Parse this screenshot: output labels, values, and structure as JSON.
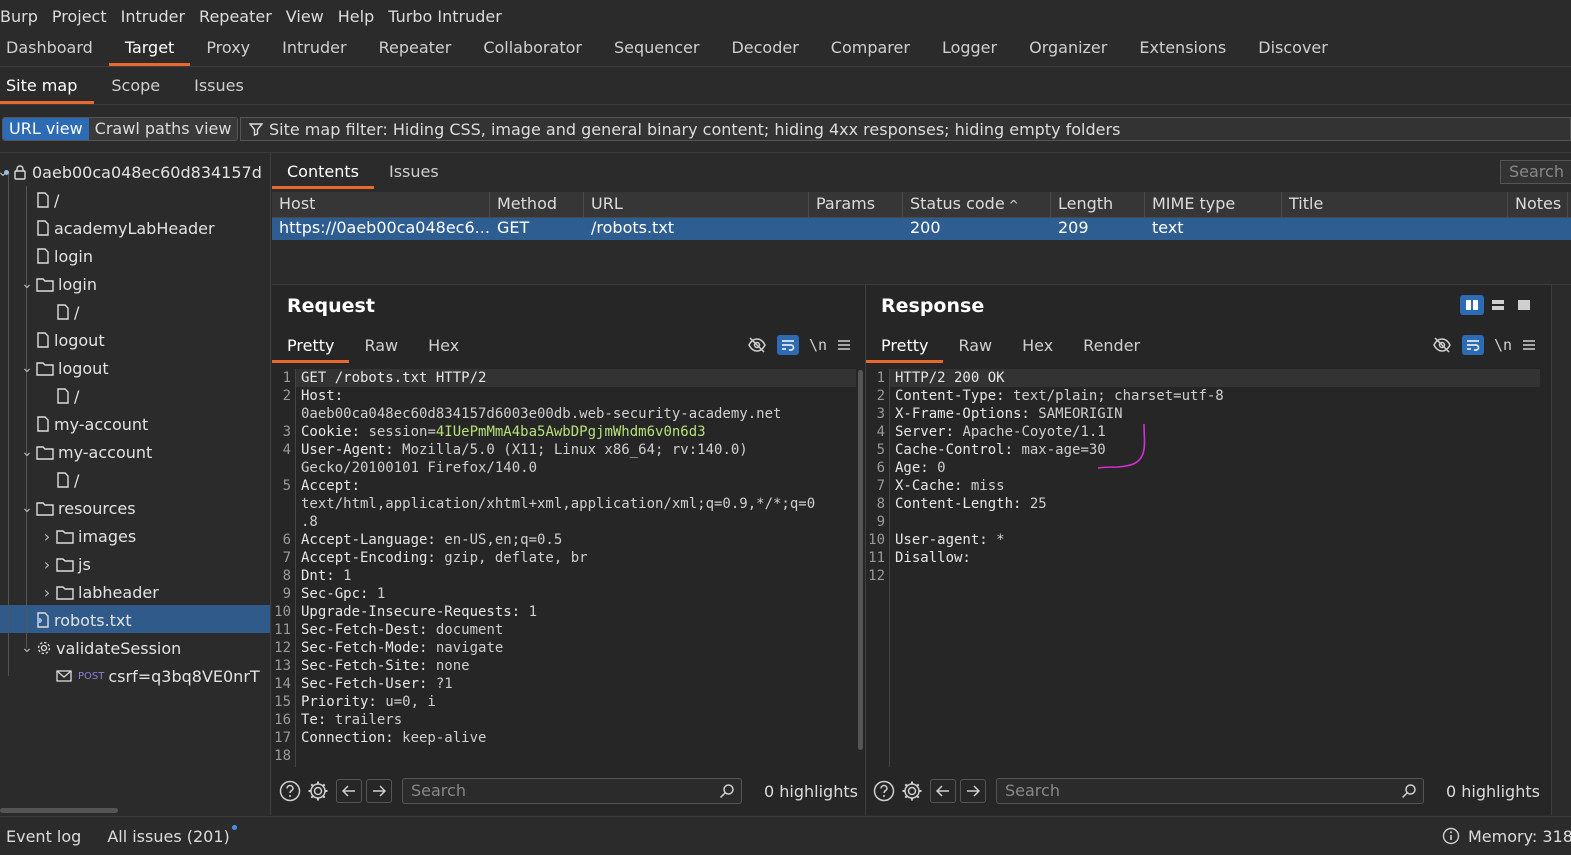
{
  "menu": [
    "Burp",
    "Project",
    "Intruder",
    "Repeater",
    "View",
    "Help",
    "Turbo Intruder"
  ],
  "main_tabs": [
    "Dashboard",
    "Target",
    "Proxy",
    "Intruder",
    "Repeater",
    "Collaborator",
    "Sequencer",
    "Decoder",
    "Comparer",
    "Logger",
    "Organizer",
    "Extensions",
    "Discover"
  ],
  "main_active": "Target",
  "sub_tabs": [
    "Site map",
    "Scope",
    "Issues"
  ],
  "view_toggle": {
    "url_view": "URL view",
    "crawl_view": "Crawl paths view"
  },
  "filter_text": "Site map filter: Hiding CSS, image and general binary content; hiding 4xx responses; hiding empty folders",
  "tree": {
    "root": "0aeb00ca048ec60d834157d",
    "items": [
      "/",
      "academyLabHeader",
      "login",
      "login",
      "/",
      "logout",
      "logout",
      "/",
      "my-account",
      "my-account",
      "/",
      "resources",
      "images",
      "js",
      "labheader",
      "robots.txt",
      "validateSession",
      "csrf=q3bq8VE0nrT"
    ],
    "post_badge": "POST"
  },
  "content_tabs": [
    "Contents",
    "Issues"
  ],
  "content_search_placeholder": "Search",
  "table": {
    "columns": [
      "Host",
      "Method",
      "URL",
      "Params",
      "Status code",
      "Length",
      "MIME type",
      "Title",
      "Notes"
    ],
    "sort_indicator": "^",
    "row": {
      "host": "https://0aeb00ca048ec6...",
      "method": "GET",
      "url": "/robots.txt",
      "params": "",
      "status": "200",
      "length": "209",
      "mime": "text",
      "title": "",
      "notes": ""
    }
  },
  "request": {
    "title": "Request",
    "tabs": [
      "Pretty",
      "Raw",
      "Hex"
    ],
    "lines": [
      {
        "n": "1",
        "k": "GET /robots.txt HTTP/2",
        "v": ""
      },
      {
        "n": "2",
        "k": "Host:",
        "v": ""
      },
      {
        "n": "",
        "k": "",
        "v": "0aeb00ca048ec60d834157d6003e00db.web-security-academy.net"
      },
      {
        "n": "3",
        "k": "Cookie:",
        "v": " session=",
        "c": "4IUePmMmA4ba5AwbDPgjmWhdm6v0n6d3"
      },
      {
        "n": "4",
        "k": "User-Agent:",
        "v": " Mozilla/5.0 (X11; Linux x86_64; rv:140.0)"
      },
      {
        "n": "",
        "k": "",
        "v": "Gecko/20100101 Firefox/140.0"
      },
      {
        "n": "5",
        "k": "Accept:",
        "v": ""
      },
      {
        "n": "",
        "k": "",
        "v": "text/html,application/xhtml+xml,application/xml;q=0.9,*/*;q=0"
      },
      {
        "n": "",
        "k": "",
        "v": ".8"
      },
      {
        "n": "6",
        "k": "Accept-Language:",
        "v": " en-US,en;q=0.5"
      },
      {
        "n": "7",
        "k": "Accept-Encoding:",
        "v": " gzip, deflate, br"
      },
      {
        "n": "8",
        "k": "Dnt:",
        "v": " 1"
      },
      {
        "n": "9",
        "k": "Sec-Gpc:",
        "v": " 1"
      },
      {
        "n": "10",
        "k": "Upgrade-Insecure-Requests:",
        "v": " 1"
      },
      {
        "n": "11",
        "k": "Sec-Fetch-Dest:",
        "v": " document"
      },
      {
        "n": "12",
        "k": "Sec-Fetch-Mode:",
        "v": " navigate"
      },
      {
        "n": "13",
        "k": "Sec-Fetch-Site:",
        "v": " none"
      },
      {
        "n": "14",
        "k": "Sec-Fetch-User:",
        "v": " ?1"
      },
      {
        "n": "15",
        "k": "Priority:",
        "v": " u=0, i"
      },
      {
        "n": "16",
        "k": "Te:",
        "v": " trailers"
      },
      {
        "n": "17",
        "k": "Connection:",
        "v": " keep-alive"
      },
      {
        "n": "18",
        "k": "",
        "v": ""
      }
    ],
    "search_placeholder": "Search",
    "highlights": "0 highlights"
  },
  "response": {
    "title": "Response",
    "tabs": [
      "Pretty",
      "Raw",
      "Hex",
      "Render"
    ],
    "lines": [
      {
        "n": "1",
        "k": "HTTP/2 200 OK",
        "v": ""
      },
      {
        "n": "2",
        "k": "Content-Type:",
        "v": " text/plain; charset=utf-8"
      },
      {
        "n": "3",
        "k": "X-Frame-Options:",
        "v": " SAMEORIGIN"
      },
      {
        "n": "4",
        "k": "Server:",
        "v": " Apache-Coyote/1.1"
      },
      {
        "n": "5",
        "k": "Cache-Control:",
        "v": " max-age=30"
      },
      {
        "n": "6",
        "k": "Age:",
        "v": " 0"
      },
      {
        "n": "7",
        "k": "X-Cache:",
        "v": " miss"
      },
      {
        "n": "8",
        "k": "Content-Length:",
        "v": " 25"
      },
      {
        "n": "9",
        "k": "",
        "v": ""
      },
      {
        "n": "10",
        "k": "User-agent:",
        "v": " *"
      },
      {
        "n": "11",
        "k": "Disallow:",
        "v": ""
      },
      {
        "n": "12",
        "k": "",
        "v": ""
      }
    ],
    "search_placeholder": "Search",
    "highlights": "0 highlights"
  },
  "status": {
    "event_log": "Event log",
    "all_issues": "All issues (201)",
    "memory": "Memory: 318"
  },
  "colors": {
    "accent": "#e8692d",
    "selection": "#2e5d92",
    "cookie_value": "#b6e07a",
    "annotation": "#d62fd6"
  }
}
